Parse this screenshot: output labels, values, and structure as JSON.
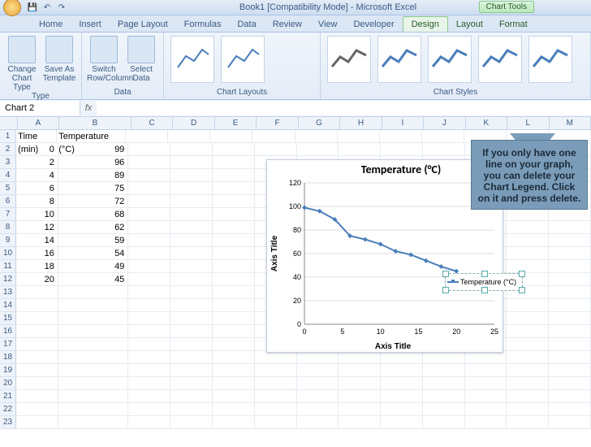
{
  "titlebar": {
    "title": "Book1 [Compatibility Mode] - Microsoft Excel",
    "chart_tools": "Chart Tools"
  },
  "tabs": [
    "Home",
    "Insert",
    "Page Layout",
    "Formulas",
    "Data",
    "Review",
    "View",
    "Developer"
  ],
  "contextual_tabs": [
    "Design",
    "Layout",
    "Format"
  ],
  "active_tab": "Design",
  "ribbon": {
    "type": {
      "change": "Change Chart Type",
      "save": "Save As Template",
      "label": "Type"
    },
    "data": {
      "switch": "Switch Row/Column",
      "select": "Select Data",
      "label": "Data"
    },
    "layouts_label": "Chart Layouts",
    "styles_label": "Chart Styles",
    "style_colors": [
      "#666666",
      "#4a7ebb",
      "#4a7ebb",
      "#4a7ebb",
      "#4a7ebb",
      "#cc4444",
      "#9abb4a"
    ]
  },
  "namebox": "Chart 2",
  "columns": [
    "A",
    "B",
    "C",
    "D",
    "E",
    "F",
    "G",
    "H",
    "I",
    "J",
    "K",
    "L",
    "M"
  ],
  "row_count": 23,
  "table": {
    "headers": [
      "Time (min)",
      "Temperature (°C)"
    ],
    "rows": [
      [
        0,
        99
      ],
      [
        2,
        96
      ],
      [
        4,
        89
      ],
      [
        6,
        75
      ],
      [
        8,
        72
      ],
      [
        10,
        68
      ],
      [
        12,
        62
      ],
      [
        14,
        59
      ],
      [
        16,
        54
      ],
      [
        18,
        49
      ],
      [
        20,
        45
      ]
    ]
  },
  "chart_data": {
    "type": "line",
    "title": "Temperature (°C)",
    "xlabel": "Axis Title",
    "ylabel": "Axis Title",
    "x": [
      0,
      2,
      4,
      6,
      8,
      10,
      12,
      14,
      16,
      18,
      20
    ],
    "y": [
      99,
      96,
      89,
      75,
      72,
      68,
      62,
      59,
      54,
      49,
      45
    ],
    "xlim": [
      0,
      25
    ],
    "ylim": [
      0,
      120
    ],
    "xticks": [
      0,
      5,
      10,
      15,
      20,
      25
    ],
    "yticks": [
      0,
      20,
      40,
      60,
      80,
      100,
      120
    ],
    "series_name": "Temperature (°C)",
    "color": "#4a7ebb"
  },
  "callout": {
    "text": "If you only have one line on your graph, you can delete your Chart Legend. Click on it and press delete."
  }
}
